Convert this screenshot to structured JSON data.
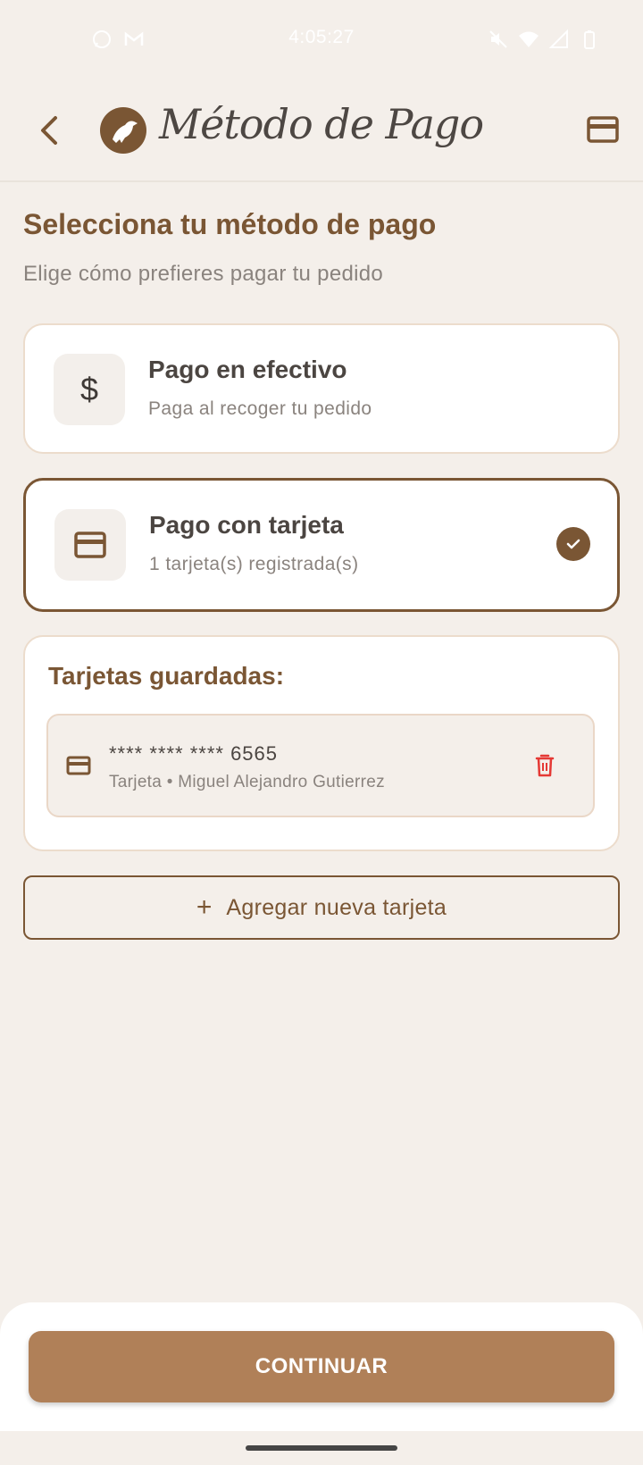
{
  "status_bar": {
    "time": "4:05:27",
    "left_icons": [
      "whatsapp-icon",
      "gmail-icon"
    ],
    "right_icons": [
      "mute-icon",
      "wifi-icon",
      "signal-icon",
      "battery-icon"
    ]
  },
  "app_bar": {
    "title": "Método de Pago",
    "back_icon": "back-arrow-icon",
    "logo": "bird-logo",
    "action_icon": "credit-card-icon"
  },
  "header": {
    "title": "Selecciona tu método de pago",
    "subtitle": "Elige cómo prefieres pagar tu pedido"
  },
  "options": [
    {
      "title": "Pago en efectivo",
      "description": "Paga al recoger tu pedido",
      "icon": "dollar-icon",
      "selected": false
    },
    {
      "title": "Pago con tarjeta",
      "description": "1 tarjeta(s) registrada(s)",
      "icon": "credit-card-icon",
      "selected": true
    }
  ],
  "saved_cards": {
    "title": "Tarjetas guardadas:",
    "items": [
      {
        "number": "**** **** **** 6565",
        "meta": "Tarjeta • Miguel Alejandro Gutierrez",
        "icon": "credit-card-icon",
        "action_icon": "delete-icon"
      }
    ]
  },
  "add_card": {
    "icon": "+",
    "label": "Agregar nueva tarjeta"
  },
  "footer": {
    "continue_label": "CONTINUAR"
  },
  "colors": {
    "brand": "#7a5634",
    "accent": "#b08058",
    "background": "#f4efea",
    "danger": "#e53935"
  }
}
